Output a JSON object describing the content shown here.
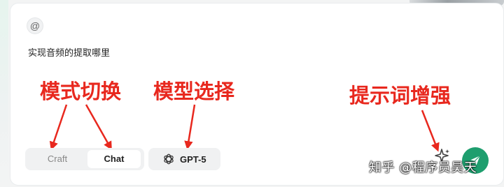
{
  "composer": {
    "at_icon": "at-sign-icon",
    "prompt_text": "实现音频的提取哪里",
    "mode_options": [
      {
        "label": "Craft",
        "selected": false
      },
      {
        "label": "Chat",
        "selected": true
      }
    ],
    "model": {
      "label": "GPT-5",
      "icon": "openai-logo-icon"
    },
    "enhance_icon": "sparkle-enhance-icon",
    "send_icon": "send-plane-icon",
    "send_color": "#1e9e6e"
  },
  "annotations": {
    "mode_switch": "模式切换",
    "model_select": "模型选择",
    "prompt_enhance": "提示词增强",
    "color": "#e8281e"
  },
  "watermark": "知乎 @程序员昊天"
}
